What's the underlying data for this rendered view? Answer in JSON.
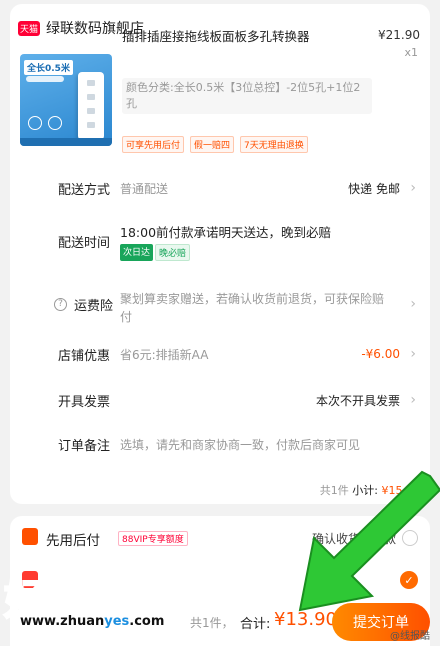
{
  "shop": {
    "badge": "天猫",
    "name": "绿联数码旗舰店"
  },
  "product": {
    "image_text": "全长0.5米",
    "title": "插排插座接拖线板面板多孔转换器",
    "price": "¥21.90",
    "quantity": "x1",
    "spec": "颜色分类:全长0.5米【3位总控】-2位5孔+1位2孔",
    "tags": [
      "可享先用后付",
      "假一赔四",
      "7天无理由退换"
    ]
  },
  "rows": {
    "shipping": {
      "label": "配送方式",
      "value": "普通配送",
      "right": "快递 免邮"
    },
    "delivery": {
      "label": "配送时间",
      "value": "18:00前付款承诺明天送达，晚到必赔",
      "badge1": "次日达",
      "badge2": "晚必赔"
    },
    "insurance": {
      "label": "运费险",
      "value": "聚划算卖家赠送，若确认收货前退货，可获保险赔付"
    },
    "discount": {
      "label": "店铺优惠",
      "value": "省6元:排插新AA",
      "right": "-¥6.00"
    },
    "invoice": {
      "label": "开具发票",
      "right": "本次不开具发票"
    },
    "note": {
      "label": "订单备注",
      "value": "选填，请先和商家协商一致，付款后商家可见"
    }
  },
  "subtotal": {
    "count": "共1件",
    "label": "小计:",
    "amount": "¥15.90"
  },
  "payment": {
    "label": "先用后付",
    "vip": "88VIP专享额度",
    "right": "确认收货后付款"
  },
  "watermark": {
    "text": "好赚网",
    "url_a": "www.zhuan",
    "url_b": "yes",
    "url_c": ".com"
  },
  "bottom": {
    "count": "共1件，",
    "total_label": "合计:",
    "total": "¥13.90",
    "submit": "提交订单",
    "weibo": "@线报酷"
  },
  "colors": {
    "accent": "#ff5000",
    "tmall": "#ff0036",
    "arrow": "#2ec835"
  }
}
